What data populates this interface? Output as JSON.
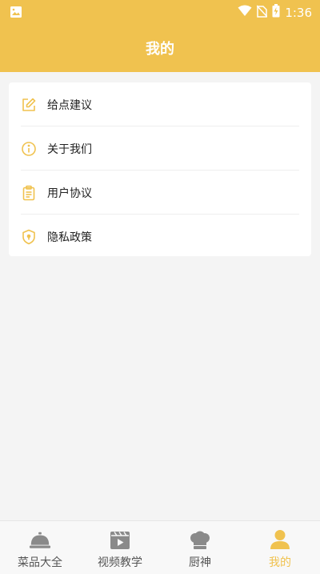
{
  "status_bar": {
    "time": "1:36"
  },
  "header": {
    "title": "我的"
  },
  "menu": {
    "items": [
      {
        "label": "给点建议",
        "icon": "edit-icon"
      },
      {
        "label": "关于我们",
        "icon": "info-icon"
      },
      {
        "label": "用户协议",
        "icon": "clipboard-icon"
      },
      {
        "label": "隐私政策",
        "icon": "shield-icon"
      }
    ]
  },
  "tabbar": {
    "items": [
      {
        "label": "菜品大全",
        "icon": "cloche-icon",
        "active": false
      },
      {
        "label": "视频教学",
        "icon": "video-icon",
        "active": false
      },
      {
        "label": "厨神",
        "icon": "chef-hat-icon",
        "active": false
      },
      {
        "label": "我的",
        "icon": "user-icon",
        "active": true
      }
    ]
  },
  "colors": {
    "accent": "#f0c24f",
    "text": "#222222",
    "inactive": "#555555",
    "background": "#f4f4f4"
  }
}
